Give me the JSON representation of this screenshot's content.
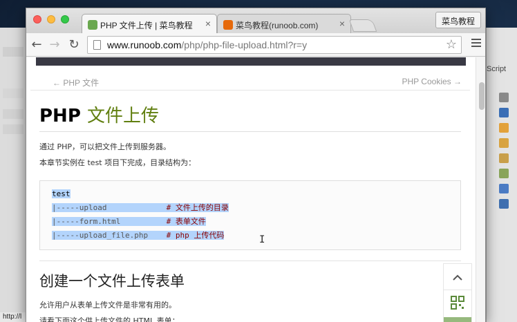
{
  "background_app": {
    "left_bottom_text": "http://l",
    "right_panel_label": "Script"
  },
  "browser": {
    "tabs": [
      {
        "label": "PHP 文件上传 | 菜鸟教程",
        "active": true,
        "favicon_color": "#6aa84f"
      },
      {
        "label": "菜鸟教程(runoob.com)",
        "active": false,
        "favicon_color": "#e66a0c"
      }
    ],
    "profile_label": "菜鸟教程",
    "url_host": "www.runoob.com",
    "url_path": "/php/php-file-upload.html?r=y"
  },
  "page": {
    "prev_link": "← PHP 文件",
    "next_link": "PHP Cookies →",
    "title_bold": "PHP",
    "title_rest": "文件上传",
    "intro1": "通过 PHP，可以把文件上传到服务器。",
    "intro2": "本章节实例在 test 项目下完成，目录结构为：",
    "code": {
      "line1": "test",
      "line2_path": "|-----upload             ",
      "line2_hash": "# ",
      "line2_cmt": "文件上传的目录",
      "line3_path": "|-----form.html          ",
      "line3_hash": "# ",
      "line3_cmt": "表单文件",
      "line4_path": "|-----upload_file.php    ",
      "line4_hash": "# php ",
      "line4_cmt": "上传代码"
    },
    "section_title": "创建一个文件上传表单",
    "para3": "允许用户从表单上传文件是非常有用的。",
    "para4": "请看下面这个供上传文件的 HTML 表单："
  },
  "floating": {
    "up_icon": "chevron-up-icon",
    "qr_icon": "qr-code-icon"
  }
}
